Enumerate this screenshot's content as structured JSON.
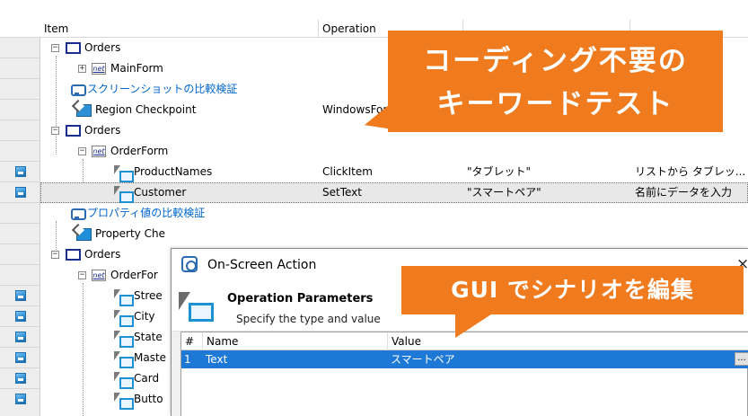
{
  "grid": {
    "columns": {
      "item": "Item",
      "operation": "Operation"
    },
    "rows": [
      {
        "item": "Orders",
        "operation": "",
        "value": "",
        "description": ""
      },
      {
        "item": "MainForm",
        "operation": "",
        "value": "",
        "description": ""
      },
      {
        "item": "スクリーンショットの比較検証",
        "operation": "",
        "value": "",
        "description": ""
      },
      {
        "item": "Region Checkpoint",
        "operation": "WindowsForm",
        "value": "",
        "description": ""
      },
      {
        "item": "Orders",
        "operation": "",
        "value": "",
        "description": ""
      },
      {
        "item": "OrderForm",
        "operation": "",
        "value": "",
        "description": ""
      },
      {
        "item": "ProductNames",
        "operation": "ClickItem",
        "value": "\"タブレット\"",
        "description": "リストから タブレッ..."
      },
      {
        "item": "Customer",
        "operation": "SetText",
        "value": "\"スマートペア\"",
        "description": "名前にデータを入力"
      },
      {
        "item": "プロパティ値の比較検証",
        "operation": "",
        "value": "",
        "description": ""
      },
      {
        "item": "Property Che",
        "operation": "",
        "value": "",
        "description": ""
      },
      {
        "item": "Orders",
        "operation": "",
        "value": "",
        "description": ""
      },
      {
        "item": "OrderFor",
        "operation": "",
        "value": "",
        "description": ""
      },
      {
        "item": "Stree",
        "operation": "",
        "value": "",
        "description": ""
      },
      {
        "item": "City",
        "operation": "",
        "value": "",
        "description": ""
      },
      {
        "item": "State",
        "operation": "",
        "value": "",
        "description": ""
      },
      {
        "item": "Maste",
        "operation": "",
        "value": "",
        "description": ""
      },
      {
        "item": "Card",
        "operation": "",
        "value": "",
        "description": ""
      },
      {
        "item": "Butto",
        "operation": "",
        "value": "",
        "description": ""
      }
    ],
    "net_badge": "net",
    "expander_minus": "−",
    "expander_plus": "+"
  },
  "callouts": {
    "top_line1": "コーディング不要の",
    "top_line2": "キーワードテスト",
    "middle": "GUI でシナリオを編集"
  },
  "dialog": {
    "title": "On-Screen Action",
    "close_glyph": "×",
    "heading": "Operation Parameters",
    "subheading": "Specify the type and value",
    "param_columns": {
      "index": "#",
      "name": "Name",
      "value": "Value"
    },
    "param_row": {
      "index": "1",
      "name": "Text",
      "value": "スマートペア",
      "ellipsis": "..."
    }
  },
  "colors": {
    "accent_orange": "#ef7b1e",
    "link_blue": "#0066cc",
    "selection_blue": "#1e78d6"
  }
}
